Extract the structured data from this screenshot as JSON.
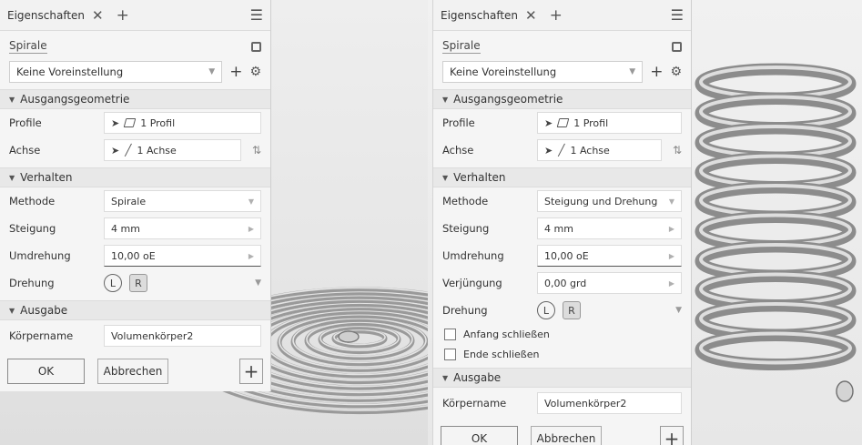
{
  "left": {
    "tab": {
      "title": "Eigenschaften",
      "close": "✕",
      "add": "+"
    },
    "menu": "☰",
    "feature_name": "Spirale",
    "preset": "Keine Voreinstellung",
    "preset_add": "+",
    "sections": {
      "input": "Ausgangsgeometrie",
      "behavior": "Verhalten",
      "output": "Ausgabe"
    },
    "profile": {
      "label": "Profile",
      "value": "1 Profil"
    },
    "axis": {
      "label": "Achse",
      "value": "1 Achse"
    },
    "method": {
      "label": "Methode",
      "value": "Spirale"
    },
    "pitch": {
      "label": "Steigung",
      "value": "4 mm"
    },
    "revolution": {
      "label": "Umdrehung",
      "value": "10,00 oE"
    },
    "rotation": {
      "label": "Drehung"
    },
    "body_name": {
      "label": "Körpername",
      "value": "Volumenkörper2"
    },
    "buttons": {
      "ok": "OK",
      "cancel": "Abbrechen",
      "plus": "+"
    }
  },
  "right": {
    "tab": {
      "title": "Eigenschaften",
      "close": "✕",
      "add": "+"
    },
    "menu": "☰",
    "feature_name": "Spirale",
    "preset": "Keine Voreinstellung",
    "preset_add": "+",
    "sections": {
      "input": "Ausgangsgeometrie",
      "behavior": "Verhalten",
      "output": "Ausgabe"
    },
    "profile": {
      "label": "Profile",
      "value": "1 Profil"
    },
    "axis": {
      "label": "Achse",
      "value": "1 Achse"
    },
    "method": {
      "label": "Methode",
      "value": "Steigung und Drehung"
    },
    "pitch": {
      "label": "Steigung",
      "value": "4 mm"
    },
    "revolution": {
      "label": "Umdrehung",
      "value": "10,00 oE"
    },
    "taper": {
      "label": "Verjüngung",
      "value": "0,00 grd"
    },
    "rotation": {
      "label": "Drehung"
    },
    "close_start": "Anfang schließen",
    "close_end": "Ende schließen",
    "body_name": {
      "label": "Körpername",
      "value": "Volumenkörper2"
    },
    "buttons": {
      "ok": "OK",
      "cancel": "Abbrechen",
      "plus": "+"
    }
  }
}
